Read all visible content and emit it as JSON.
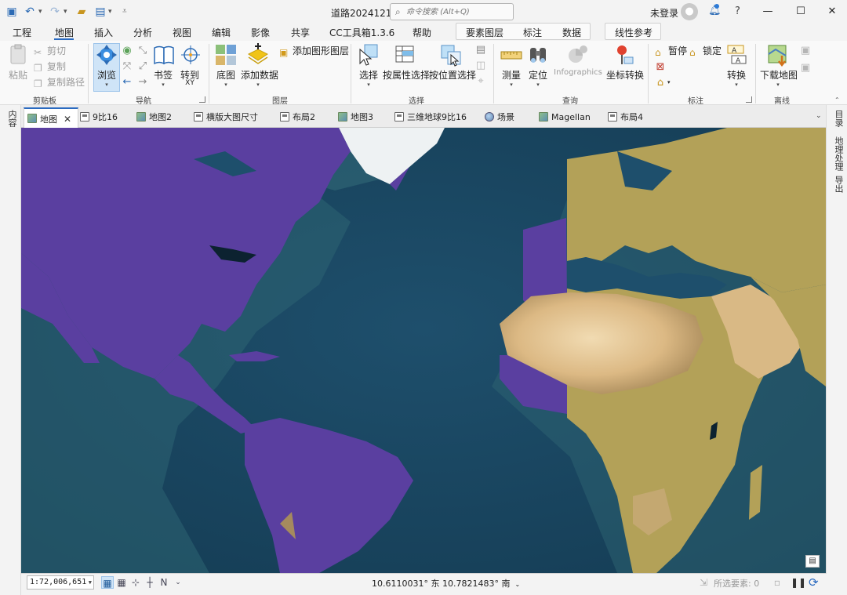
{
  "window": {
    "title": "道路20241219",
    "search_placeholder": "命令搜索 (Alt+Q)",
    "user": "未登录",
    "help": "?",
    "minimize": "—",
    "maximize": "☐",
    "close": "✕"
  },
  "ribbon_tabs": [
    "工程",
    "地图",
    "插入",
    "分析",
    "视图",
    "编辑",
    "影像",
    "共享",
    "CC工具箱1.3.6",
    "帮助"
  ],
  "active_ribbon_tab": "地图",
  "context_tabs": [
    "要素图层",
    "标注",
    "数据"
  ],
  "context_tab_extra": "线性参考",
  "clipboard": {
    "paste": "粘贴",
    "cut": "剪切",
    "copy": "复制",
    "copy_path": "复制路径",
    "group": "剪贴板"
  },
  "navigate": {
    "explore": "浏览",
    "bookmarks": "书签",
    "goto_xy": "转到\nXY",
    "goto_label": "转到",
    "xy_label": "XY",
    "group": "导航"
  },
  "layer": {
    "basemap": "底图",
    "add_data": "添加数据",
    "add_graphics": "添加图形图层",
    "group": "图层"
  },
  "selection": {
    "select": "选择",
    "by_attribute": "按属性选择",
    "by_location": "按位置选择",
    "group": "选择"
  },
  "inquiry": {
    "measure": "测量",
    "locate": "定位",
    "infographics": "Infographics",
    "convert_coords": "坐标转换",
    "group": "查询"
  },
  "labeling": {
    "pause": "暂停",
    "lock": "锁定",
    "convert": "转换",
    "group": "标注"
  },
  "offline": {
    "download_map": "下载地图",
    "group": "离线"
  },
  "left_dock": {
    "contents": "内容"
  },
  "right_dock": {
    "catalog": "目录",
    "geoprocessing": "地理处理",
    "export": "导出"
  },
  "doc_tabs": [
    {
      "label": "地图",
      "kind": "map",
      "active": true
    },
    {
      "label": "9比16",
      "kind": "layout"
    },
    {
      "label": "地图2",
      "kind": "map"
    },
    {
      "label": "横版大图尺寸",
      "kind": "layout"
    },
    {
      "label": "布局2",
      "kind": "layout"
    },
    {
      "label": "地图3",
      "kind": "map"
    },
    {
      "label": "三维地球9比16",
      "kind": "layout"
    },
    {
      "label": "场景",
      "kind": "globe"
    },
    {
      "label": "Magellan",
      "kind": "map"
    },
    {
      "label": "布局4",
      "kind": "layout"
    }
  ],
  "status": {
    "scale": "1:72,006,651",
    "coordinates": "10.6110031° 东 10.7821483° 南",
    "selected_features": "所选要素: 0"
  },
  "colors": {
    "americas_fill": "#5a3fa0",
    "afro_eurasia_fill": "#b3a158",
    "ocean_deep": "#17425c",
    "ocean_shelf": "#2f6a78",
    "accent": "#2a6ac0"
  }
}
